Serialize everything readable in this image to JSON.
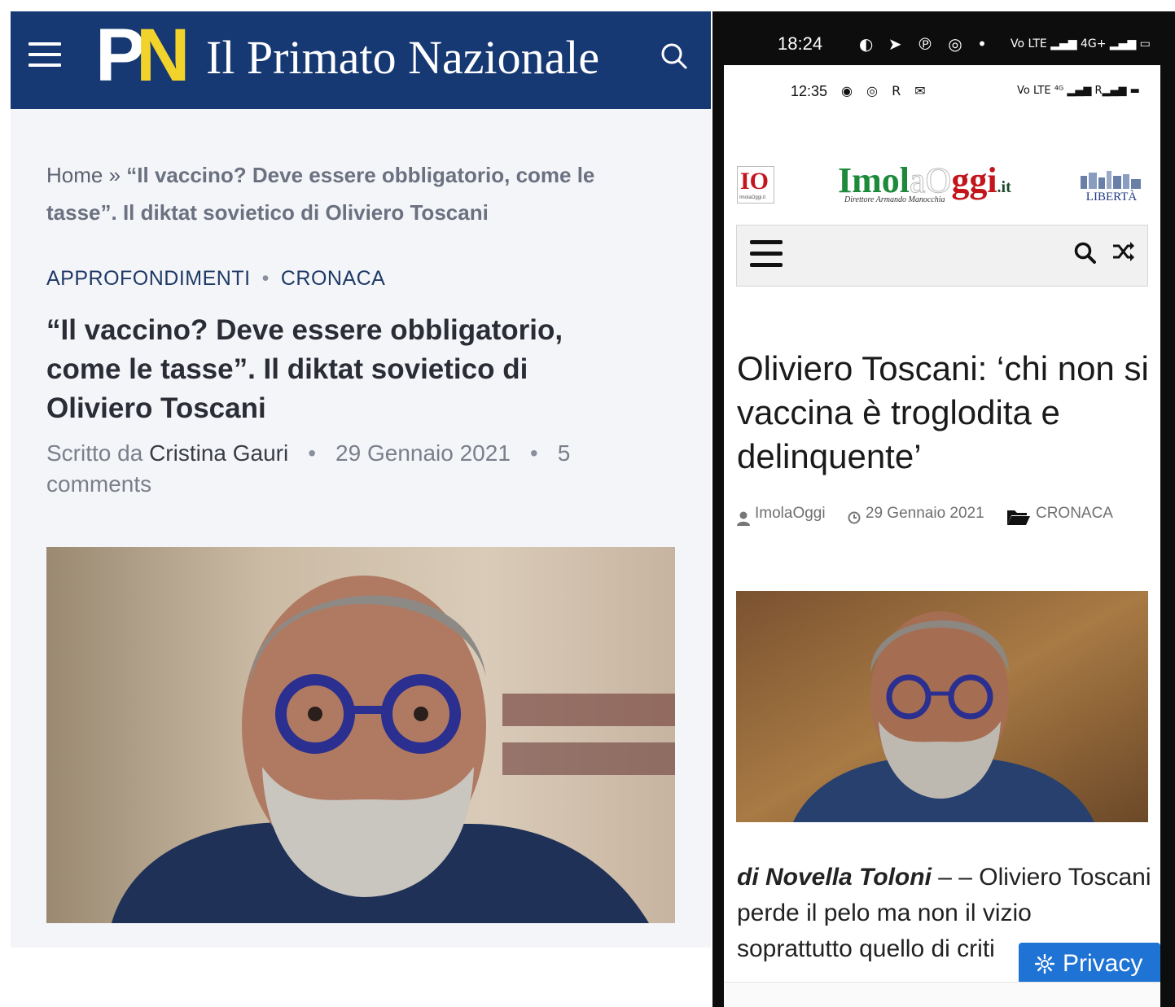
{
  "left": {
    "site_title": "Il Primato Nazionale",
    "logo_letters": {
      "p": "P",
      "n": "N"
    },
    "breadcrumb": {
      "home": "Home",
      "separator": "»",
      "current": "“Il vaccino? Deve essere obbligatorio, come le tasse”. Il diktat sovietico di Oliviero Toscani"
    },
    "categories": [
      "APPROFONDIMENTI",
      "CRONACA"
    ],
    "category_separator": "•",
    "headline": "“Il vaccino? Deve essere obbligatorio, come le tasse”. Il diktat sovietico di Oliviero Toscani",
    "meta": {
      "written_by": "Scritto da",
      "author": "Cristina Gauri",
      "separator": "•",
      "date": "29 Gennaio 2021",
      "comments": "5 comments"
    },
    "colors": {
      "header": "#163873",
      "logo_accent": "#f2d32c",
      "category": "#1f3a66"
    },
    "icons": [
      "menu-icon",
      "search-icon"
    ]
  },
  "right": {
    "outer_status": {
      "time": "18:24",
      "icons": "◐ ➤ ℗ ◎ •",
      "right": "Vo LTE ▂▄▆ 4G+ ▂▄▆ ▭"
    },
    "inner_status": {
      "time": "12:35",
      "icons": "◉ ◎ R ✉",
      "right": "Vo LTE ⁴ᴳ ▂▄▆ R▂▄▆ ▬"
    },
    "io_badge": {
      "label": "IO",
      "small": "ImolaOggi.it"
    },
    "logo": {
      "imol": "Imol",
      "a": "a",
      "o": "O",
      "ggi": "ggi",
      "it": ".it",
      "tagline": "Direttore Armando Manocchia"
    },
    "piazza_label": "LIBERTÀ",
    "headline": "Oliviero Toscani: ‘chi non si vaccina è troglodita e delinquente’",
    "meta": {
      "author": "ImolaOggi",
      "date": "29 Gennaio 2021",
      "category": "CRONACA"
    },
    "body": {
      "byline": "di Novella Toloni",
      "text": " – – Oliviero Toscani perde il pelo ma non il vizio soprattutto quello di criti"
    },
    "privacy_label": "Privacy",
    "colors": {
      "privacy": "#1e73d4",
      "logo_green": "#1c8a3a",
      "logo_red": "#c3161c"
    },
    "icons": [
      "menu-icon",
      "search-icon",
      "shuffle-icon",
      "user-icon",
      "clock-icon",
      "folder-icon",
      "gear-icon"
    ]
  }
}
